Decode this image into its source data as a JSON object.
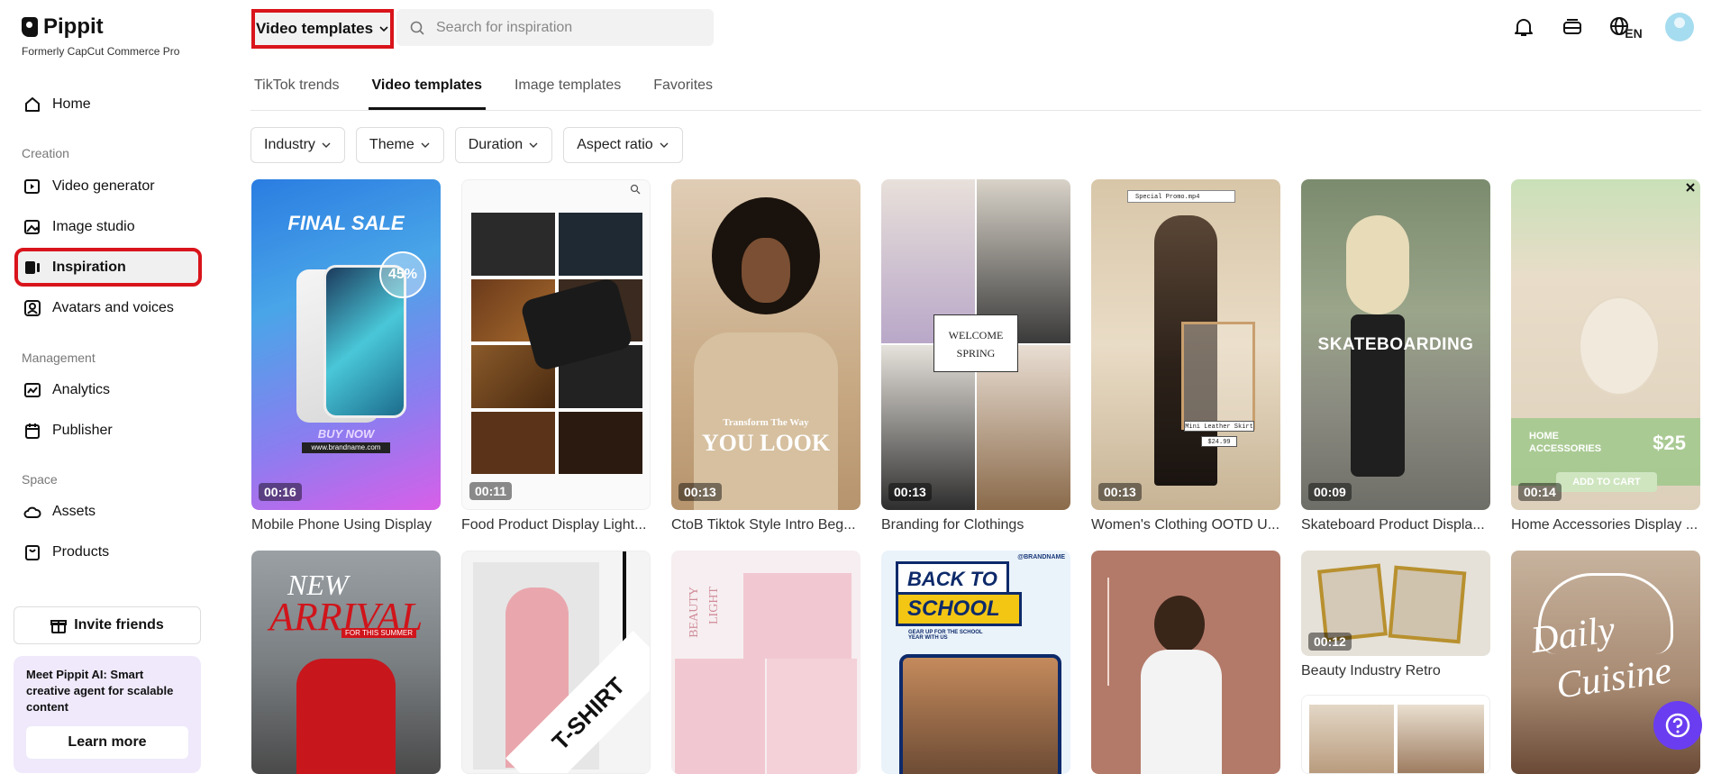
{
  "brand": {
    "name": "Pippit",
    "subtitle": "Formerly CapCut Commerce Pro"
  },
  "sidebar": {
    "home": "Home",
    "creation_label": "Creation",
    "creation": [
      "Video generator",
      "Image studio",
      "Inspiration",
      "Avatars and voices"
    ],
    "management_label": "Management",
    "management": [
      "Analytics",
      "Publisher"
    ],
    "space_label": "Space",
    "space": [
      "Assets",
      "Products"
    ],
    "invite": "Invite friends",
    "promo_text": "Meet Pippit AI: Smart creative agent for scalable content",
    "learn_more": "Learn more"
  },
  "topbar": {
    "template_select": "Video templates",
    "search_placeholder": "Search for inspiration",
    "lang": "EN"
  },
  "tabs": [
    "TikTok trends",
    "Video templates",
    "Image templates",
    "Favorites"
  ],
  "filters": [
    "Industry",
    "Theme",
    "Duration",
    "Aspect ratio"
  ],
  "cards_row1": [
    {
      "title": "Mobile Phone Using Display",
      "duration": "00:16",
      "text1": "FINAL SALE",
      "text2": "45%",
      "text3": "BUY NOW",
      "text4": "www.brandname.com"
    },
    {
      "title": "Food Product Display Light...",
      "duration": "00:11"
    },
    {
      "title": "CtoB Tiktok Style Intro Beg...",
      "duration": "00:13",
      "text1": "Transform The Way",
      "text2": "YOU LOOK"
    },
    {
      "title": "Branding for Clothings",
      "duration": "00:13",
      "text1": "WELCOME",
      "text2": "SPRING"
    },
    {
      "title": "Women's Clothing OOTD U...",
      "duration": "00:13",
      "text1": "Special Promo.mp4",
      "text2": "Mini Leather Skirt",
      "text3": "$24.99"
    },
    {
      "title": "Skateboard Product Displa...",
      "duration": "00:09",
      "text1": "SKATEBOARDING"
    },
    {
      "title": "Home Accessories Display ...",
      "duration": "00:14",
      "text1": "HOME ACCESSORIES",
      "text2": "$25",
      "text3": "ADD TO CART"
    }
  ],
  "cards_row2": [
    {
      "text1": "NEW",
      "text2": "ARRIVAL",
      "text3": "FOR THIS SUMMER"
    },
    {
      "text1": "T-SHIRT"
    },
    {
      "text1": "BEAUTY",
      "text2": "LIGHT"
    },
    {
      "text1": "BACK TO",
      "text2": "SCHOOL",
      "text3": "GEAR UP FOR THE SCHOOL YEAR WITH US",
      "text4": "@BRANDNAME"
    },
    {},
    {
      "title": "Beauty Industry Retro",
      "duration": "00:12"
    },
    {
      "text1": "Daily",
      "text2": "Cuisine"
    }
  ],
  "colors": {
    "highlight": "#d9141b",
    "accent": "#6a3df0",
    "promo_bg": "#efe9fb"
  }
}
